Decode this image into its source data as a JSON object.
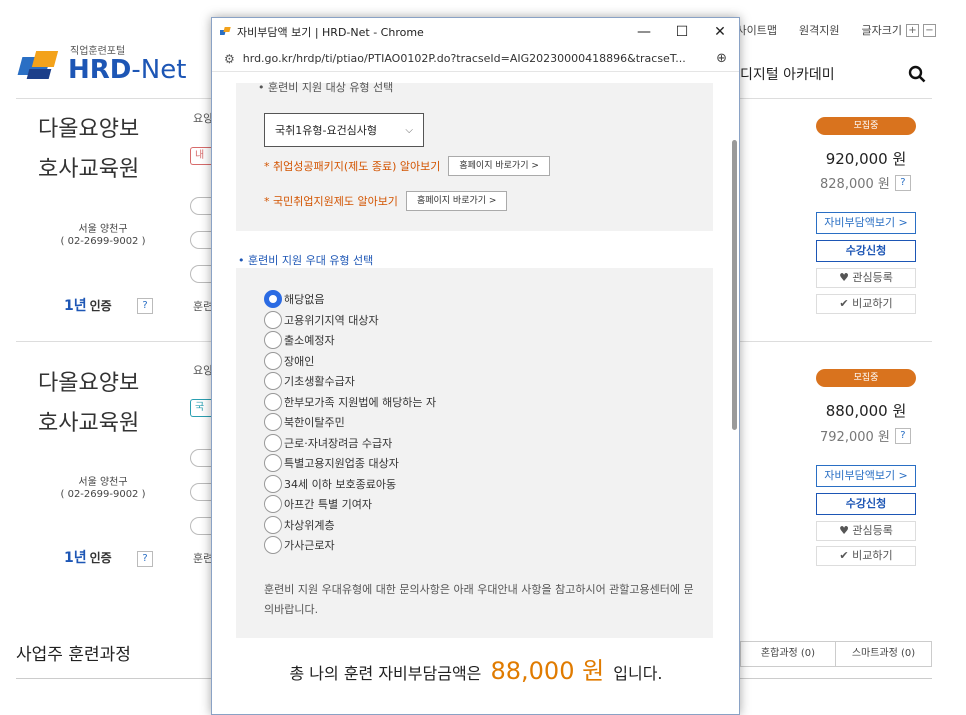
{
  "topnav": {
    "sitemap": "사이트맵",
    "remote": "원격지원",
    "fontsize": "글자크기",
    "plus": "+",
    "minus": "−"
  },
  "logo": {
    "sub": "직업훈련포털",
    "hrd": "HRD",
    "dash": "-",
    "net": "Net"
  },
  "header": {
    "digital": "디지털 아카데미",
    "search_icon": "search-icon"
  },
  "cards": [
    {
      "title_line1": "다올요양보",
      "title_line2": "호사교육원",
      "addr1": "서울 양천구",
      "addr2": "( 02-2699-9002 )",
      "cert": "인증",
      "cert_prefix": "1년",
      "q": "?",
      "peek_top": "요양",
      "peek_tag": "내",
      "peek_bottom": "훈련",
      "status": "모집중",
      "price": "920,000 원",
      "dprice": "828,000 원",
      "self_btn": "자비부담액보기 >",
      "apply_btn": "수강신청",
      "fav_btn": "♥  관심등록",
      "cmp_btn": "✔  비교하기"
    },
    {
      "title_line1": "다올요양보",
      "title_line2": "호사교육원",
      "addr1": "서울 양천구",
      "addr2": "( 02-2699-9002 )",
      "cert": "인증",
      "cert_prefix": "1년",
      "q": "?",
      "peek_top": "요양",
      "peek_tag": "국",
      "peek_bottom": "훈련",
      "status": "모집중",
      "price": "880,000 원",
      "dprice": "792,000 원",
      "self_btn": "자비부담액보기 >",
      "apply_btn": "수강신청",
      "fav_btn": "♥  관심등록",
      "cmp_btn": "✔  비교하기"
    }
  ],
  "biz": {
    "title": "사업주 훈련과정",
    "tab1": "혼합과정 (0)",
    "tab2": "스마트과정 (0)"
  },
  "popup": {
    "window_title": "자비부담액 보기 | HRD-Net - Chrome",
    "url": "hrd.go.kr/hrdp/ti/ptiao/PTIAO0102P.do?tracseId=AIG20230000418896&tracseT...",
    "min": "—",
    "max": "☐",
    "close": "✕",
    "cut_heading": "• 훈련비 지원 대상 유형 선택",
    "select_value": "국취1유형-요건심사형",
    "notice1": "* 취업성공패키지(제도 종료) 알아보기",
    "notice2": "* 국민취업지원제도 알아보기",
    "homepage_btn": "홈페이지 바로가기 >",
    "section_title": "• 훈련비 지원 우대 유형 선택",
    "options": [
      "해당없음",
      "고용위기지역 대상자",
      "출소예정자",
      "장애인",
      "기초생활수급자",
      "한부모가족 지원법에 해당하는 자",
      "북한이탈주민",
      "근로·자녀장려금 수급자",
      "특별고용지원업종 대상자",
      "34세 이하 보호종료아동",
      "아프간 특별 기여자",
      "차상위계층",
      "가사근로자"
    ],
    "selected_index": 0,
    "help_text": "훈련비 지원 우대유형에 대한 문의사항은 아래 우대안내 사항을 참고하시어 관할고용센터에 문의바랍니다.",
    "total_prefix": "총 나의 훈련 자비부담금액은",
    "total_amount": "88,000 원",
    "total_suffix": "입니다."
  },
  "colors": {
    "accent": "#1d56b5",
    "orange": "#d9731e",
    "radio": "#2b6be3"
  }
}
